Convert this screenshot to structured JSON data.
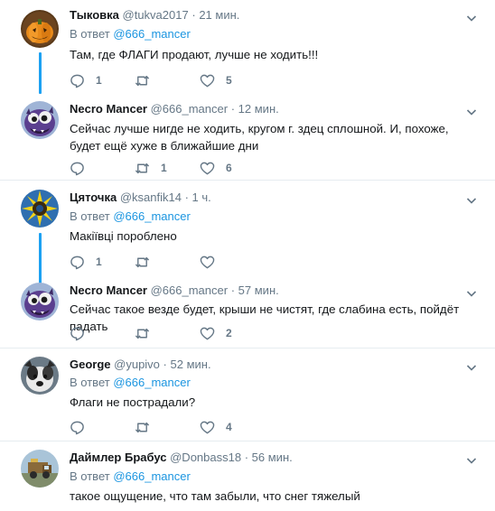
{
  "tweets": [
    {
      "name": "Тыковка",
      "handle": "@tukva2017",
      "separator": "·",
      "time": "21 мин.",
      "reply_prefix": "В ответ",
      "reply_mention": "@666_mancer",
      "text": "Там, где ФЛАГИ продают, лучше не ходить!!!",
      "replies": "1",
      "retweets": "",
      "likes": "5",
      "avatar_icon": "pumpkin-avatar"
    },
    {
      "name": "Necro Mancer",
      "handle": "@666_mancer",
      "separator": "·",
      "time": "12 мин.",
      "text": "Сейчас лучше нигде не ходить, кругом г.  здец сплошной. И, похоже, будет ещё хуже в ближайшие дни",
      "replies": "",
      "retweets": "1",
      "likes": "6",
      "avatar_icon": "purple-monster-avatar"
    },
    {
      "name": "Цяточка",
      "handle": "@ksanfik14",
      "separator": "·",
      "time": "1 ч.",
      "reply_prefix": "В ответ",
      "reply_mention": "@666_mancer",
      "text": "Макіївці пороблено",
      "replies": "1",
      "retweets": "",
      "likes": "",
      "avatar_icon": "sunflower-avatar"
    },
    {
      "name": "Necro Mancer",
      "handle": "@666_mancer",
      "separator": "·",
      "time": "57 мин.",
      "text": "Сейчас такое везде будет, крыши не чистят, где слабина есть, пойдёт падать",
      "replies": "",
      "retweets": "",
      "likes": "2",
      "avatar_icon": "purple-monster-avatar"
    },
    {
      "name": "George",
      "handle": "@yupivo",
      "separator": "·",
      "time": "52 мин.",
      "reply_prefix": "В ответ",
      "reply_mention": "@666_mancer",
      "text": "Флаги не пострадали?",
      "replies": "",
      "retweets": "",
      "likes": "4",
      "avatar_icon": "dog-avatar"
    },
    {
      "name": "Даймлер Брабус",
      "handle": "@Donbass18",
      "separator": "·",
      "time": "56 мин.",
      "reply_prefix": "В ответ",
      "reply_mention": "@666_mancer",
      "text": "такое ощущение, что там забыли, что снег тяжелый",
      "avatar_icon": "truck-avatar"
    }
  ],
  "colors": {
    "accent": "#1da1f2",
    "link": "#1b95e0",
    "secondary": "#657786",
    "divider": "#e6ecf0"
  }
}
